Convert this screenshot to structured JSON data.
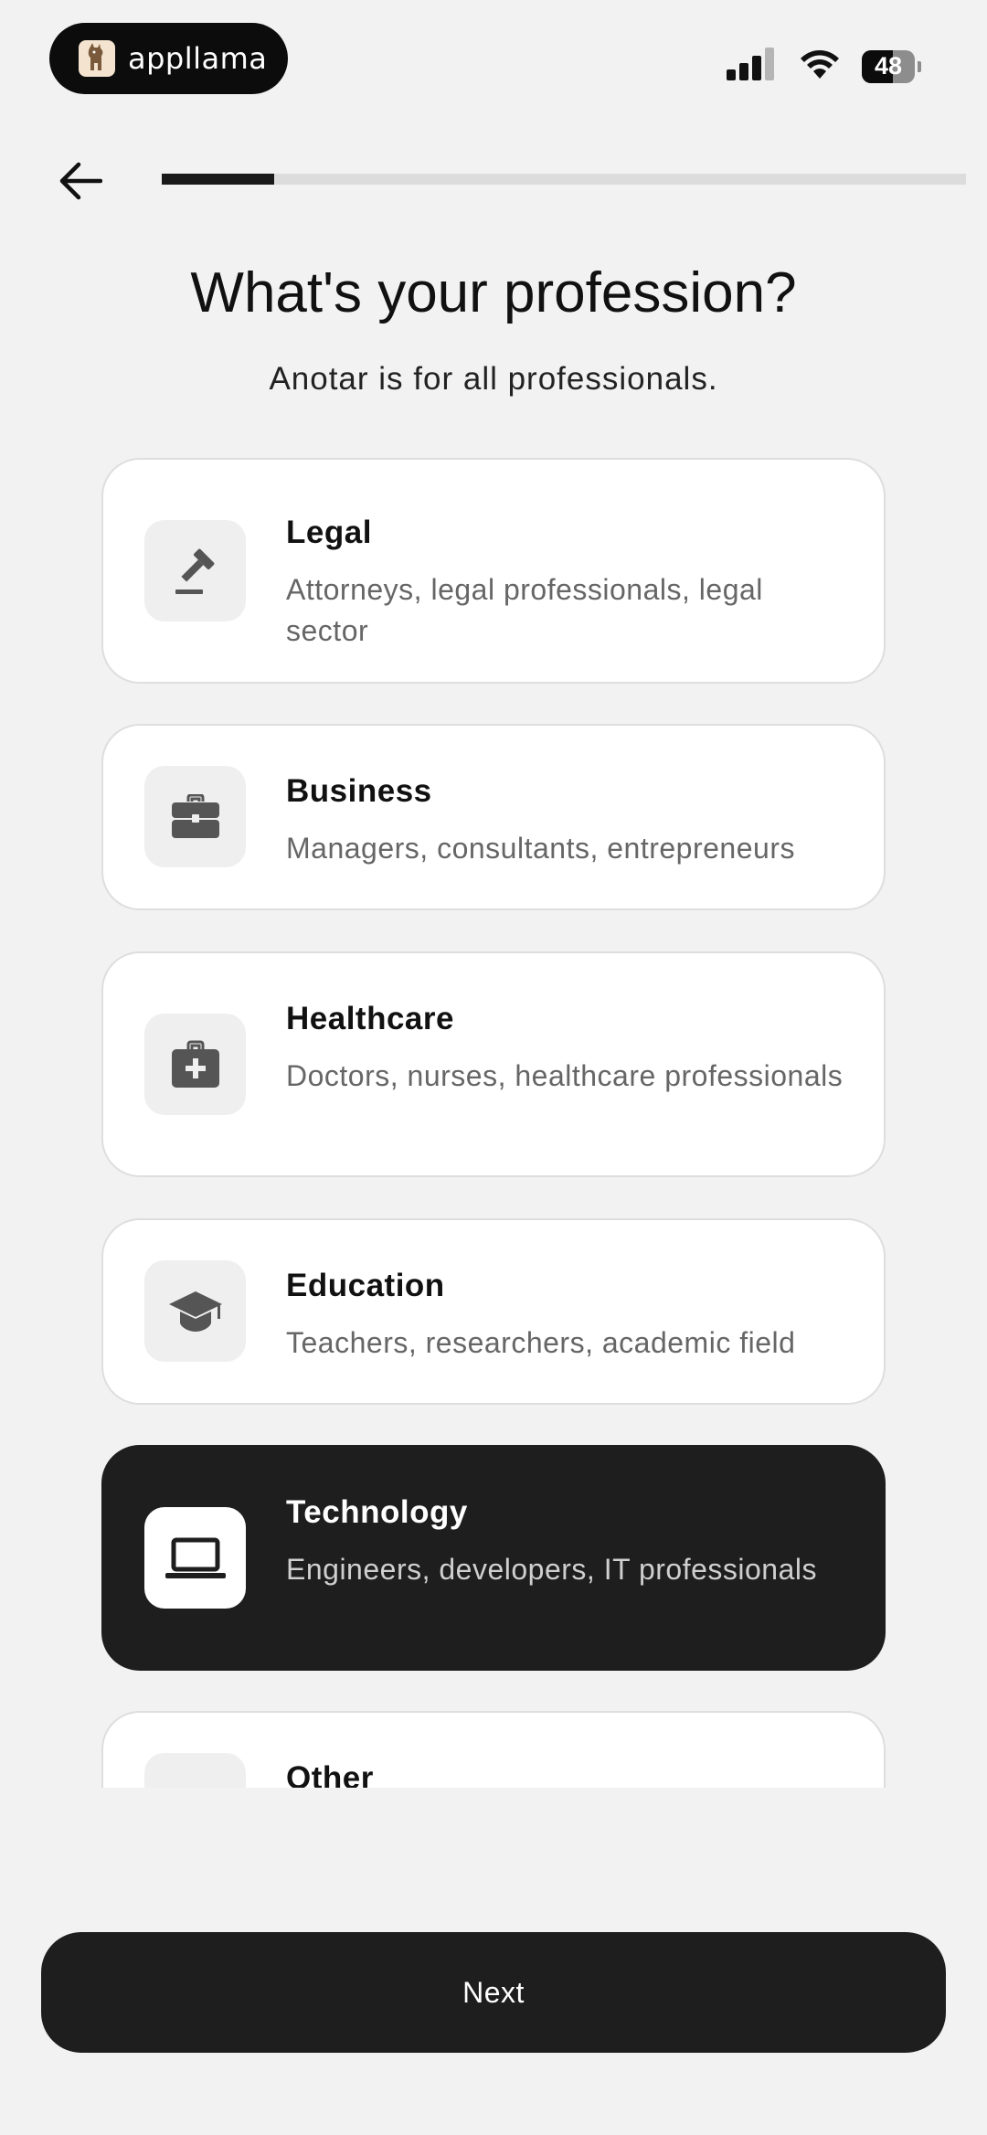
{
  "status_bar": {
    "brand_name": "appllama",
    "brand_icon": "llama-logo-icon",
    "battery_level": "48"
  },
  "header": {
    "back_icon": "arrow-left-icon",
    "progress_percent": 14
  },
  "page": {
    "title": "What's your profession?",
    "subtitle": "Anotar is for all professionals."
  },
  "professions": [
    {
      "label": "Legal",
      "description": "Attorneys, legal professionals, legal sector",
      "icon": "gavel-icon",
      "selected": false
    },
    {
      "label": "Business",
      "description": "Managers, consultants, entrepreneurs",
      "icon": "briefcase-icon",
      "selected": false
    },
    {
      "label": "Healthcare",
      "description": "Doctors, nurses, healthcare professionals",
      "icon": "medical-bag-icon",
      "selected": false
    },
    {
      "label": "Education",
      "description": "Teachers, researchers, academic field",
      "icon": "graduation-cap-icon",
      "selected": false
    },
    {
      "label": "Technology",
      "description": "Engineers, developers, IT professionals",
      "icon": "laptop-icon",
      "selected": true
    },
    {
      "label": "Other",
      "description": "",
      "icon": "other-icon",
      "selected": false
    }
  ],
  "footer": {
    "next_label": "Next"
  },
  "colors": {
    "background": "#f2f2f2",
    "selected_card": "#1e1e1f",
    "button": "#1e1e1f"
  }
}
